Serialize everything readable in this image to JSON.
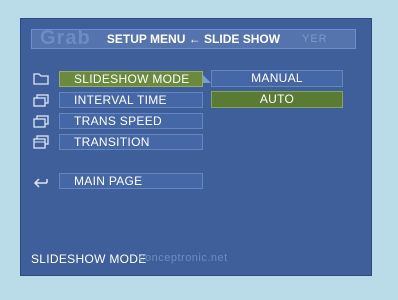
{
  "header": {
    "title": "SETUP MENU ← SLIDE SHOW",
    "watermark_left": "Grab",
    "watermark_right": "YER"
  },
  "menu": {
    "items": [
      {
        "label": "SLIDESHOW MODE",
        "icon": "slideshow-mode-icon",
        "selected": true
      },
      {
        "label": "INTERVAL TIME",
        "icon": "interval-time-icon",
        "selected": false
      },
      {
        "label": "TRANS SPEED",
        "icon": "trans-speed-icon",
        "selected": false
      },
      {
        "label": "TRANSITION",
        "icon": "transition-icon",
        "selected": false
      }
    ],
    "back": {
      "label": "MAIN PAGE",
      "icon": "return-arrow-icon"
    }
  },
  "options": [
    {
      "label": "MANUAL",
      "selected": false
    },
    {
      "label": "AUTO",
      "selected": true
    }
  ],
  "footer": {
    "status": "SLIDESHOW MODE",
    "watermark": "conceptronic.net"
  },
  "colors": {
    "background": "#b9dce8",
    "screen": "#3f5f9a",
    "item": "#4667a6",
    "selected_item": "#6b8a3d",
    "active_option": "#5a7b33"
  }
}
